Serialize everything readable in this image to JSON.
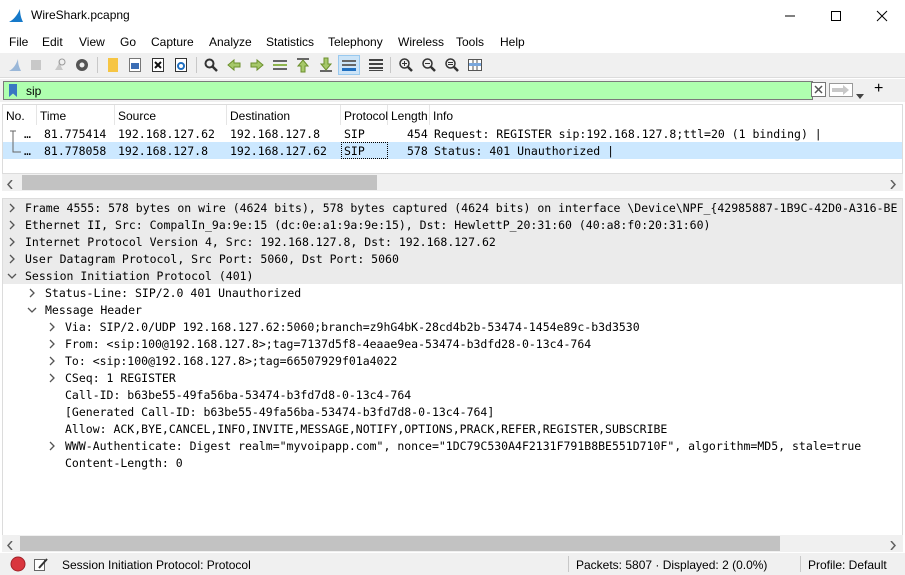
{
  "window": {
    "title": "WireShark.pcapng"
  },
  "menu": [
    "File",
    "Edit",
    "View",
    "Go",
    "Capture",
    "Analyze",
    "Statistics",
    "Telephony",
    "Wireless",
    "Tools",
    "Help"
  ],
  "filter": {
    "value": "sip"
  },
  "packet_list": {
    "columns": [
      "No.",
      "Time",
      "Source",
      "Destination",
      "Protocol",
      "Length",
      "Info"
    ],
    "rows": [
      {
        "no": "…",
        "time": "81.775414",
        "source": "192.168.127.62",
        "destination": "192.168.127.8",
        "protocol": "SIP",
        "length": "454",
        "info": "Request: REGISTER sip:192.168.127.8;ttl=20  (1 binding) |",
        "selected": false
      },
      {
        "no": "…",
        "time": "81.778058",
        "source": "192.168.127.8",
        "destination": "192.168.127.62",
        "protocol": "SIP",
        "length": "578",
        "info": "Status: 401 Unauthorized |",
        "selected": true
      }
    ]
  },
  "details": [
    {
      "text": "Frame 4555: 578 bytes on wire (4624 bits), 578 bytes captured (4624 bits) on interface \\Device\\NPF_{42985887-1B9C-42D0-A316-BE",
      "level": 0,
      "state": "collapsed",
      "shaded": true
    },
    {
      "text": "Ethernet II, Src: CompalIn_9a:9e:15 (dc:0e:a1:9a:9e:15), Dst: HewlettP_20:31:60 (40:a8:f0:20:31:60)",
      "level": 0,
      "state": "collapsed",
      "shaded": true
    },
    {
      "text": "Internet Protocol Version 4, Src: 192.168.127.8, Dst: 192.168.127.62",
      "level": 0,
      "state": "collapsed",
      "shaded": true
    },
    {
      "text": "User Datagram Protocol, Src Port: 5060, Dst Port: 5060",
      "level": 0,
      "state": "collapsed",
      "shaded": true
    },
    {
      "text": "Session Initiation Protocol (401)",
      "level": 0,
      "state": "expanded",
      "shaded": true
    },
    {
      "text": "Status-Line: SIP/2.0 401 Unauthorized",
      "level": 1,
      "state": "collapsed",
      "shaded": false
    },
    {
      "text": "Message Header",
      "level": 1,
      "state": "expanded",
      "shaded": false
    },
    {
      "text": "Via: SIP/2.0/UDP 192.168.127.62:5060;branch=z9hG4bK-28cd4b2b-53474-1454e89c-b3d3530",
      "level": 2,
      "state": "collapsed",
      "shaded": false
    },
    {
      "text": "From: <sip:100@192.168.127.8>;tag=7137d5f8-4eaae9ea-53474-b3dfd28-0-13c4-764",
      "level": 2,
      "state": "collapsed",
      "shaded": false
    },
    {
      "text": "To: <sip:100@192.168.127.8>;tag=66507929f01a4022",
      "level": 2,
      "state": "collapsed",
      "shaded": false
    },
    {
      "text": "CSeq: 1 REGISTER",
      "level": 2,
      "state": "collapsed",
      "shaded": false
    },
    {
      "text": "Call-ID: b63be55-49fa56ba-53474-b3fd7d8-0-13c4-764",
      "level": 2,
      "state": "leaf",
      "shaded": false
    },
    {
      "text": "[Generated Call-ID: b63be55-49fa56ba-53474-b3fd7d8-0-13c4-764]",
      "level": 2,
      "state": "leaf",
      "shaded": false
    },
    {
      "text": "Allow: ACK,BYE,CANCEL,INFO,INVITE,MESSAGE,NOTIFY,OPTIONS,PRACK,REFER,REGISTER,SUBSCRIBE",
      "level": 2,
      "state": "leaf",
      "shaded": false
    },
    {
      "text": "WWW-Authenticate: Digest realm=\"myvoipapp.com\", nonce=\"1DC79C530A4F2131F791B8BE551D710F\", algorithm=MD5, stale=true",
      "level": 2,
      "state": "collapsed",
      "shaded": false
    },
    {
      "text": "Content-Length: 0",
      "level": 2,
      "state": "leaf",
      "shaded": false
    }
  ],
  "status": {
    "field_info": "Session Initiation Protocol: Protocol",
    "packets": "Packets: 5807 · Displayed: 2 (0.0%)",
    "profile": "Profile: Default"
  },
  "colors": {
    "filter_valid": "#afffaf",
    "selected_row": "#cce8ff",
    "shaded_row": "#ebebeb"
  }
}
